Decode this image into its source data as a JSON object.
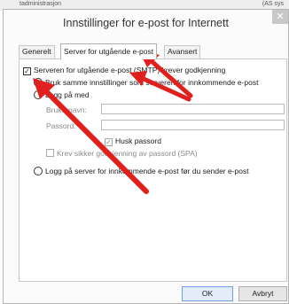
{
  "background": {
    "left_text": "tadministrasjon",
    "right_text": "(AS sys"
  },
  "dialog": {
    "title": "Innstillinger for e-post for Internett",
    "close_glyph": "✕"
  },
  "tabs": [
    {
      "label": "Generelt"
    },
    {
      "label": "Server for utgående e-post"
    },
    {
      "label": "Avansert"
    }
  ],
  "options": {
    "requires_auth": {
      "label": "Serveren for utgående e-post (SMTP) krever godkjenning",
      "checked": true
    },
    "same_settings": {
      "label": "Bruk samme innstillinger som serveren for innkommende e-post",
      "selected": true
    },
    "logon_with": {
      "label": "Logg på med",
      "selected": false
    },
    "username_label": "Brukernavn:",
    "password_label": "Passord:",
    "remember_password": {
      "label": "Husk passord",
      "checked": true
    },
    "spa": {
      "label": "Krev sikker godkjenning av passord (SPA)",
      "checked": false
    },
    "logon_incoming_first": {
      "label": "Logg på server for innkommende e-post før du sender e-post",
      "selected": false
    }
  },
  "buttons": {
    "ok": "OK",
    "cancel": "Avbryt"
  },
  "colors": {
    "arrow": "#e0201c",
    "ok_border": "#6d9ee0"
  }
}
